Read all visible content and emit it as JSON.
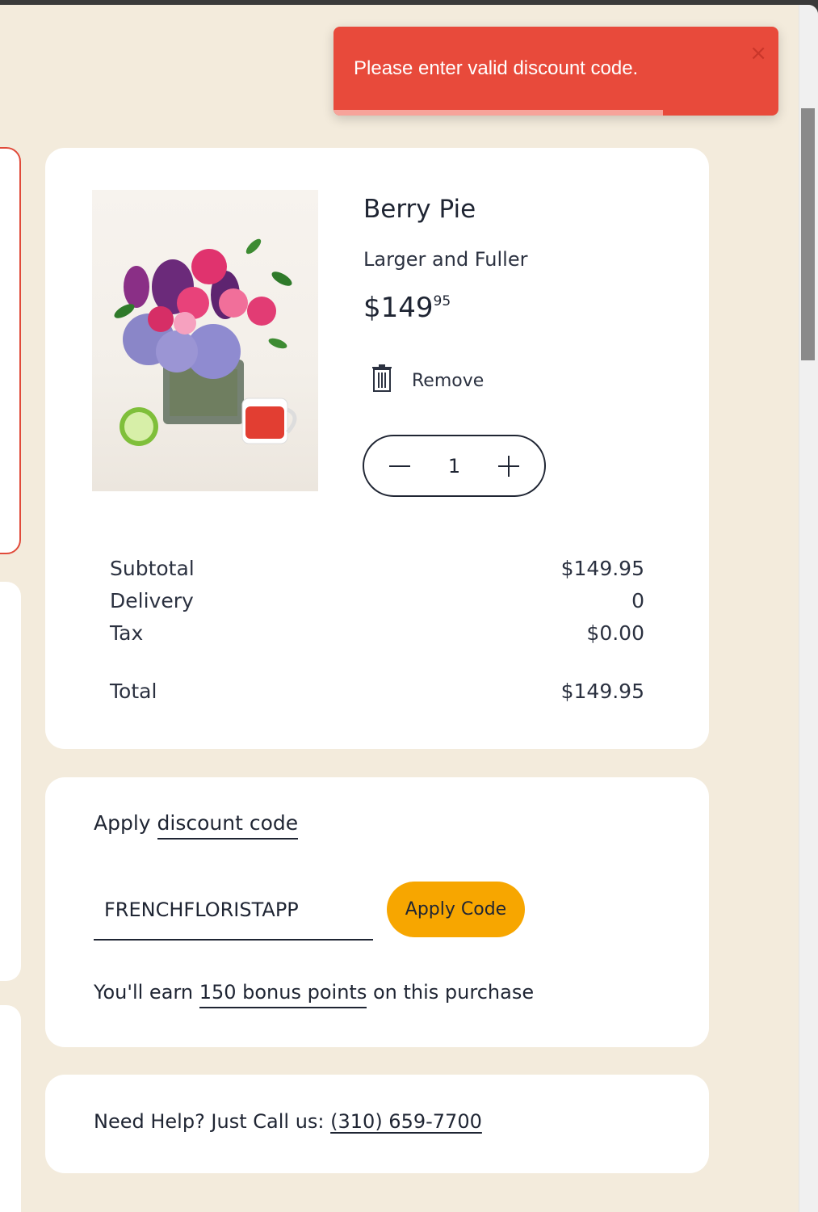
{
  "toast": {
    "message": "Please enter valid discount code.",
    "close_symbol": "×",
    "progress": 0.74,
    "color": "#e84a3b"
  },
  "product": {
    "name": "Berry Pie",
    "variant": "Larger and Fuller",
    "price_main": "$149",
    "price_cents": "95",
    "remove_label": "Remove",
    "quantity": "1"
  },
  "summary": {
    "subtotal_label": "Subtotal",
    "subtotal_value": "$149.95",
    "delivery_label": "Delivery",
    "delivery_value": "0",
    "tax_label": "Tax",
    "tax_value": "$0.00",
    "total_label": "Total",
    "total_value": "$149.95"
  },
  "discount": {
    "title_prefix": "Apply",
    "title_link": "discount code",
    "code_value": "FRENCHFLORISTAPP",
    "apply_label": "Apply Code",
    "bonus_prefix": "You'll earn",
    "bonus_link": "150 bonus points",
    "bonus_suffix": "on this purchase",
    "apply_color": "#f7a600"
  },
  "help": {
    "text": "Need Help? Just Call us:",
    "phone": "(310) 659-7700"
  },
  "icons": {
    "remove": "trash-icon",
    "minus": "minus-icon",
    "plus": "plus-icon",
    "close": "close-icon"
  }
}
